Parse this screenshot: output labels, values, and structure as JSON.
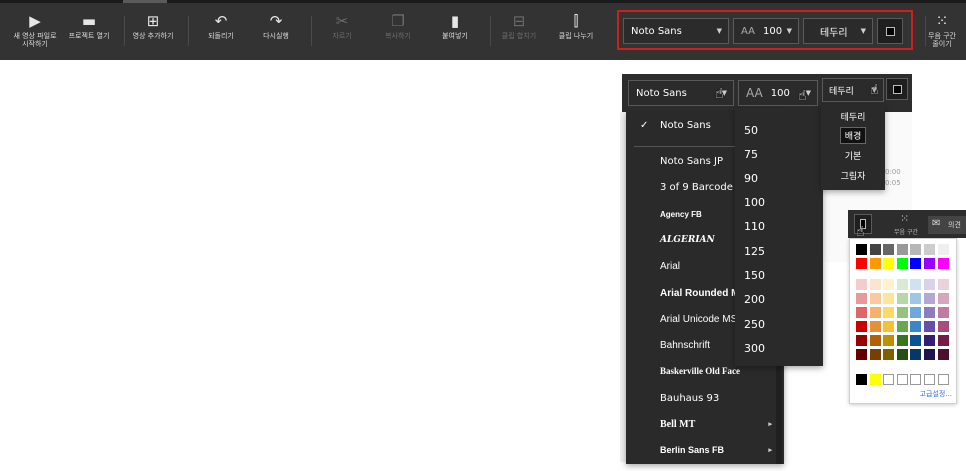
{
  "toolbar": {
    "buttons": [
      {
        "label": "새 영상 파일로\n시작하기",
        "icon": "play-square-icon"
      },
      {
        "label": "프로젝트 열기",
        "icon": "clapper-icon"
      },
      {
        "label": "영상 추가하기",
        "icon": "add-square-icon"
      },
      {
        "label": "되돌리기",
        "icon": "undo-icon"
      },
      {
        "label": "다시실행",
        "icon": "redo-icon"
      },
      {
        "label": "자르기",
        "icon": "scissors-icon"
      },
      {
        "label": "복사하기",
        "icon": "copy-icon"
      },
      {
        "label": "붙여넣기",
        "icon": "paste-icon"
      },
      {
        "label": "클립 합치기",
        "icon": "merge-icon"
      },
      {
        "label": "클립 나누기",
        "icon": "split-icon"
      }
    ],
    "font": "Noto Sans",
    "size": "100",
    "style": "테두리",
    "right_button": "무음 구간\n줄이기",
    "icon_glyphs": {
      "play": "▶",
      "clap": "▬",
      "add": "⊞",
      "undo": "↶",
      "redo": "↷",
      "cut": "✂",
      "copy": "❐",
      "paste": "▮",
      "merge": "⊟",
      "split": "⫿",
      "silence": "⁙"
    }
  },
  "overlay": {
    "font": "Noto Sans",
    "size_icon": "AA",
    "size": "100",
    "style": "테두리",
    "font_list": [
      "Noto Sans",
      "Noto Sans JP",
      "3 of 9 Barcode",
      "Agency FB",
      "ALGERIAN",
      "Arial",
      "Arial Rounded MT",
      "Arial Unicode MS",
      "Bahnschrift",
      "Baskerville Old Face",
      "Bauhaus 93",
      "Bell MT",
      "Berlin Sans FB"
    ],
    "size_list": [
      "50",
      "75",
      "90",
      "100",
      "110",
      "125",
      "150",
      "200",
      "250",
      "300"
    ],
    "style_list": [
      "테두리",
      "배경",
      "기본",
      "그림자"
    ],
    "mini_toolbar_label": "무음 구간",
    "mini_other_label": "의견",
    "side_times": [
      "0:00",
      "0:05"
    ],
    "palette_advanced": "고급설정...",
    "checkmark": "✓",
    "arrow": "▼",
    "submenu_arrow": "▸",
    "cursor": "☝"
  },
  "palette": {
    "row1": [
      "#000000",
      "#434343",
      "#666666",
      "#999999",
      "#b7b7b7",
      "#cccccc",
      "#efefef"
    ],
    "row2": [
      "#ff0000",
      "#ff9900",
      "#ffff00",
      "#00ff00",
      "#0000ff",
      "#9900ff",
      "#ff00ff"
    ],
    "grid": [
      [
        "#f4cccc",
        "#fce5cd",
        "#fff2cc",
        "#d9ead3",
        "#cfe2f3",
        "#d9d2e9",
        "#ead1dc"
      ],
      [
        "#ea9999",
        "#f9cb9c",
        "#ffe599",
        "#b6d7a8",
        "#9fc5e8",
        "#b4a7d6",
        "#d5a6bd"
      ],
      [
        "#e06666",
        "#f6b26b",
        "#ffd966",
        "#93c47d",
        "#6fa8dc",
        "#8e7cc3",
        "#c27ba0"
      ],
      [
        "#cc0000",
        "#e69138",
        "#f1c232",
        "#6aa84f",
        "#3d85c6",
        "#674ea7",
        "#a64d79"
      ],
      [
        "#990000",
        "#b45f06",
        "#bf9000",
        "#38761d",
        "#0b5394",
        "#351c75",
        "#741b47"
      ],
      [
        "#660000",
        "#783f04",
        "#7f6000",
        "#274e13",
        "#073763",
        "#20124d",
        "#4c1130"
      ]
    ],
    "recent": [
      "#000000",
      "#ffff00",
      "#ffffff",
      "#ffffff",
      "#ffffff",
      "#ffffff",
      "#ffffff"
    ]
  }
}
